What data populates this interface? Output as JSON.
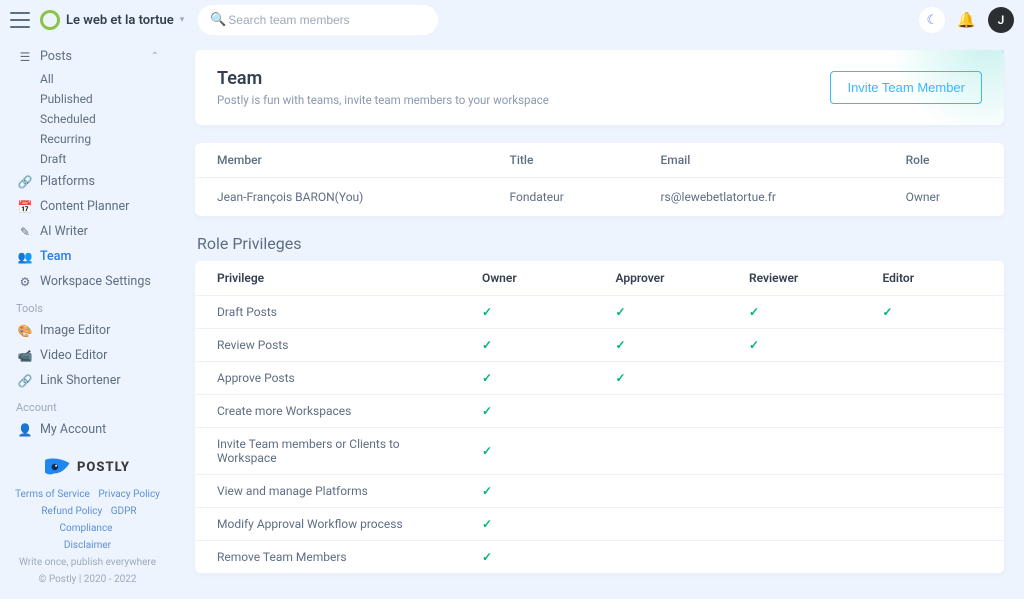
{
  "brand": "Le web et la tortue",
  "search": {
    "placeholder": "Search team members"
  },
  "avatar": {
    "letter": "J"
  },
  "sidebar": {
    "posts": {
      "label": "Posts",
      "items": [
        "All",
        "Published",
        "Scheduled",
        "Recurring",
        "Draft"
      ]
    },
    "nav": [
      {
        "label": "Platforms",
        "icon": "🔗"
      },
      {
        "label": "Content Planner",
        "icon": "📅"
      },
      {
        "label": "AI Writer",
        "icon": "✎"
      },
      {
        "label": "Team",
        "icon": "👥",
        "active": true
      },
      {
        "label": "Workspace Settings",
        "icon": "⚙"
      }
    ],
    "tools_title": "Tools",
    "tools": [
      {
        "label": "Image Editor",
        "icon": "🎨"
      },
      {
        "label": "Video Editor",
        "icon": "📹"
      },
      {
        "label": "Link Shortener",
        "icon": "🔗"
      }
    ],
    "account_title": "Account",
    "account": [
      {
        "label": "My Account",
        "icon": "👤"
      }
    ],
    "postly": "POSTLY",
    "footer": {
      "tos": "Terms of Service",
      "privacy": "Privacy Policy",
      "refund": "Refund Policy",
      "gdpr": "GDPR Compliance",
      "disclaimer": "Disclaimer",
      "tagline": "Write once, publish everywhere",
      "copyright": "© Postly | 2020 - 2022"
    }
  },
  "team": {
    "title": "Team",
    "subtitle": "Postly is fun with teams, invite team members to your workspace",
    "invite_btn": "Invite Team Member",
    "headers": {
      "member": "Member",
      "title": "Title",
      "email": "Email",
      "role": "Role"
    },
    "rows": [
      {
        "member": "Jean-François BARON(You)",
        "title": "Fondateur",
        "email": "rs@lewebetlatortue.fr",
        "role": "Owner"
      }
    ]
  },
  "privileges": {
    "title": "Role Privileges",
    "headers": [
      "Privilege",
      "Owner",
      "Approver",
      "Reviewer",
      "Editor"
    ],
    "rows": [
      {
        "name": "Draft Posts",
        "cols": [
          true,
          true,
          true,
          true
        ]
      },
      {
        "name": "Review Posts",
        "cols": [
          true,
          true,
          true,
          false
        ]
      },
      {
        "name": "Approve Posts",
        "cols": [
          true,
          true,
          false,
          false
        ]
      },
      {
        "name": "Create more Workspaces",
        "cols": [
          true,
          false,
          false,
          false
        ]
      },
      {
        "name": "Invite Team members or Clients to Workspace",
        "cols": [
          true,
          false,
          false,
          false
        ]
      },
      {
        "name": "View and manage Platforms",
        "cols": [
          true,
          false,
          false,
          false
        ]
      },
      {
        "name": "Modify Approval Workflow process",
        "cols": [
          true,
          false,
          false,
          false
        ]
      },
      {
        "name": "Remove Team Members",
        "cols": [
          true,
          false,
          false,
          false
        ]
      }
    ]
  }
}
